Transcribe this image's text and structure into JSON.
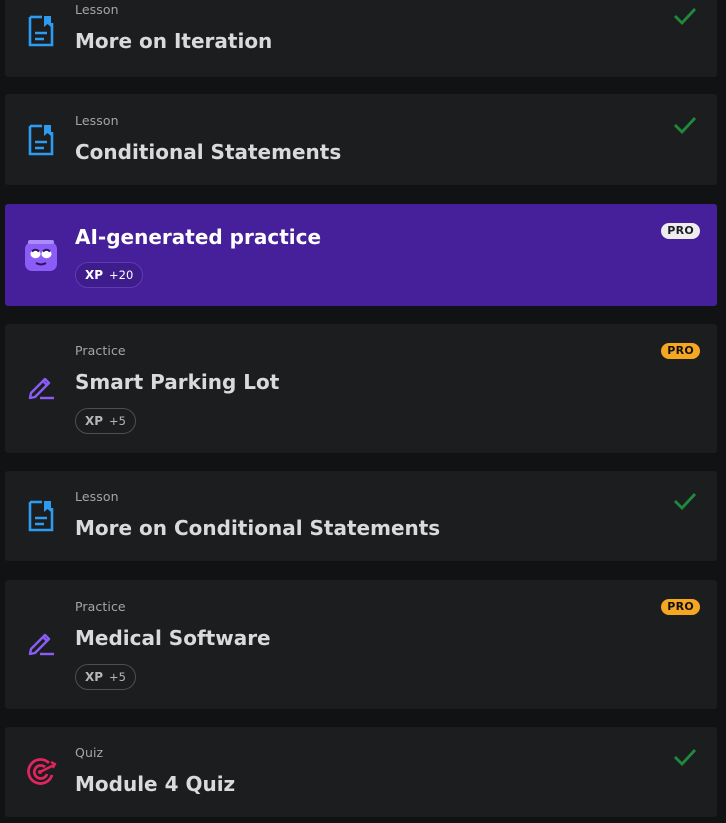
{
  "colors": {
    "background": "#111213",
    "card": "#1c1d1f",
    "ai_card": "#46209a",
    "check": "#1f8a3b",
    "lesson_icon": "#2d9bf0",
    "practice_icon": "#8b5cf6",
    "quiz_icon": "#e0245e",
    "pro_badge": "#f5a623"
  },
  "items": [
    {
      "kind": "Lesson",
      "title": "More on Iteration",
      "icon": "lesson-document-icon",
      "completed": true
    },
    {
      "kind": "Lesson",
      "title": "Conditional Statements",
      "icon": "lesson-document-icon",
      "completed": true
    },
    {
      "kind": "",
      "title": "AI-generated practice",
      "icon": "ai-robot-icon",
      "badge": "PRO",
      "xp_label": "XP",
      "xp_value": "+20"
    },
    {
      "kind": "Practice",
      "title": "Smart Parking Lot",
      "icon": "practice-pencil-icon",
      "badge": "PRO",
      "xp_label": "XP",
      "xp_value": "+5"
    },
    {
      "kind": "Lesson",
      "title": "More on Conditional Statements",
      "icon": "lesson-document-icon",
      "completed": true
    },
    {
      "kind": "Practice",
      "title": "Medical Software",
      "icon": "practice-pencil-icon",
      "badge": "PRO",
      "xp_label": "XP",
      "xp_value": "+5"
    },
    {
      "kind": "Quiz",
      "title": "Module 4 Quiz",
      "icon": "quiz-target-icon",
      "completed": true
    }
  ]
}
